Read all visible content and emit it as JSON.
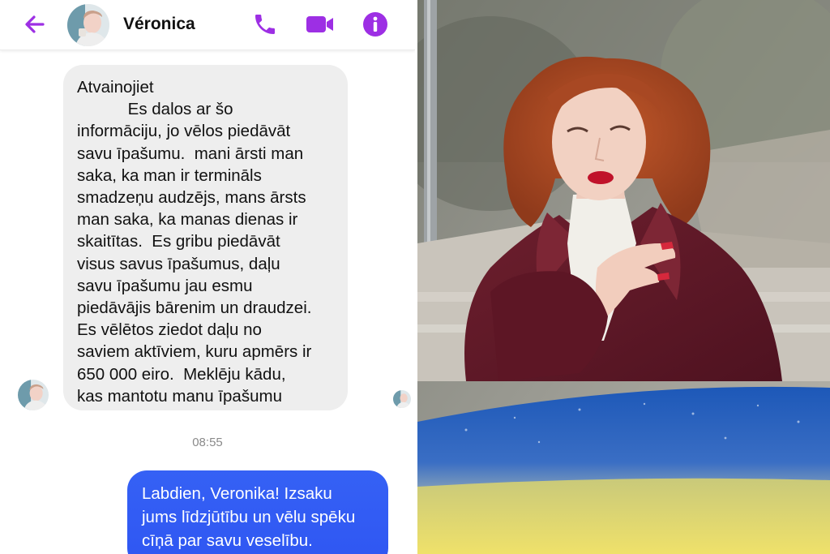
{
  "header": {
    "contact_name": "Véronica"
  },
  "icons": {
    "back": "arrow-left-icon",
    "call": "phone-icon",
    "video": "video-camera-icon",
    "info": "info-icon"
  },
  "colors": {
    "accent": "#9d2fe4",
    "incoming_bubble": "#eeeeee",
    "outgoing_bubble": "#3561f5"
  },
  "messages": {
    "incoming": "Atvainojiet\n           Es dalos ar šo\ninformāciju, jo vēlos piedāvāt\nsavu īpašumu.  mani ārsti man\nsaka, ka man ir termināls\nsmadzeņu audzējs, mans ārsts\nman saka, ka manas dienas ir\nskaitītas.  Es gribu piedāvāt\nvisus savus īpašumus, daļu\nsavu īpašumu jau esmu\npiedāvājis bārenim un draudzei.\nEs vēlētos ziedot daļu no\nsaviem aktīviem, kuru apmērs ir\n650 000 eiro.  Meklēju kādu,\nkas mantotu manu īpašumu",
    "timestamp": "08:55",
    "outgoing": "Labdien, Veronika! Izsaku\njums līdzjūtību un vēlu spēku\ncīņā par savu veselību."
  }
}
